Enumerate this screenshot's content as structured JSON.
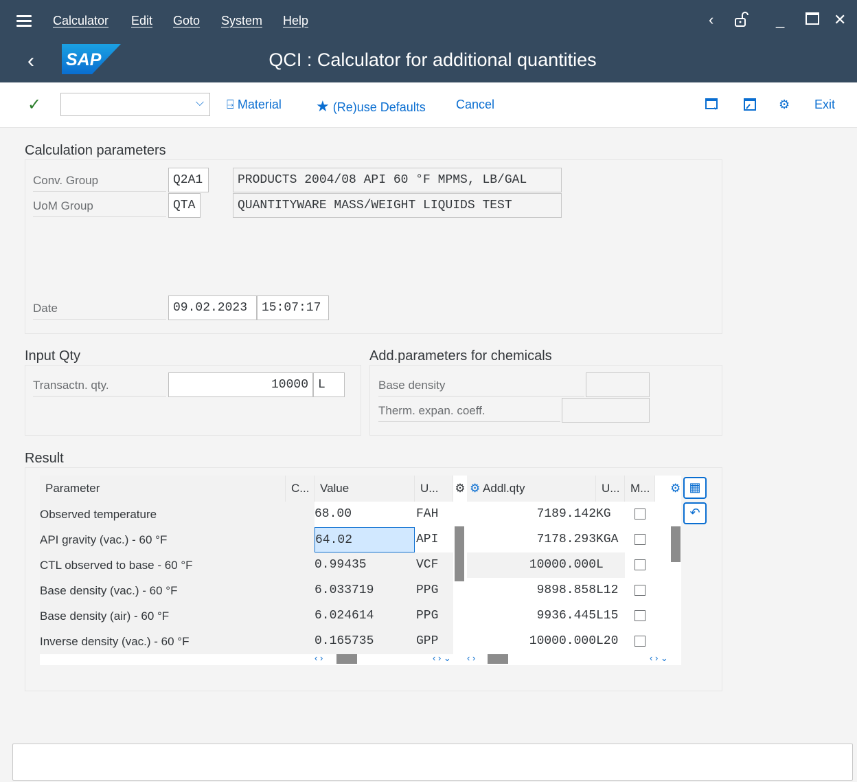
{
  "menubar": {
    "items": [
      "Calculator",
      "Edit",
      "Goto",
      "System",
      "Help"
    ]
  },
  "window": {
    "title": "QCI : Calculator for additional quantities",
    "logo": "SAP"
  },
  "toolbar": {
    "material_label": "Material",
    "defaults_label": "(Re)use Defaults",
    "cancel_label": "Cancel",
    "exit_label": "Exit"
  },
  "calc_params": {
    "section_title": "Calculation parameters",
    "conv_group_label": "Conv. Group",
    "conv_group_value": "Q2A1",
    "conv_group_desc": "PRODUCTS 2004/08 API 60 °F MPMS, LB/GAL",
    "uom_group_label": "UoM Group",
    "uom_group_value": "QTA",
    "uom_group_desc": "QUANTITYWARE MASS/WEIGHT LIQUIDS TEST",
    "date_label": "Date",
    "date_value": "09.02.2023",
    "time_value": "15:07:17"
  },
  "input_qty": {
    "section_title": "Input Qty",
    "trans_label": "Transactn. qty.",
    "trans_value": "10000",
    "trans_unit": "L"
  },
  "chem_params": {
    "section_title": "Add.parameters for chemicals",
    "base_density_label": "Base density",
    "therm_label": "Therm. expan. coeff."
  },
  "result": {
    "section_title": "Result",
    "headers": {
      "parameter": "Parameter",
      "c": "C...",
      "value": "Value",
      "u1": "U...",
      "addl_qty": "Addl.qty",
      "u2": "U...",
      "m": "M..."
    },
    "rows": [
      {
        "parameter": "Observed temperature",
        "value": "68.00",
        "unit": "FAH",
        "addl": "7189.142",
        "addl_unit": "KG"
      },
      {
        "parameter": "API gravity (vac.) - 60 °F",
        "value": "64.02",
        "unit": "API",
        "addl": "7178.293",
        "addl_unit": "KGA"
      },
      {
        "parameter": "CTL observed to base - 60 °F",
        "value": "0.99435",
        "unit": "VCF",
        "addl": "10000.000",
        "addl_unit": "L"
      },
      {
        "parameter": "Base density (vac.) - 60 °F",
        "value": "6.033719",
        "unit": "PPG",
        "addl": "9898.858",
        "addl_unit": "L12"
      },
      {
        "parameter": "Base density (air) - 60 °F",
        "value": "6.024614",
        "unit": "PPG",
        "addl": "9936.445",
        "addl_unit": "L15"
      },
      {
        "parameter": "Inverse density (vac.) - 60 °F",
        "value": "0.165735",
        "unit": "GPP",
        "addl": "10000.000",
        "addl_unit": "L20"
      }
    ]
  },
  "colors": {
    "shell": "#354a5f",
    "accent": "#0a6ed1",
    "check": "#2b7d2b"
  }
}
